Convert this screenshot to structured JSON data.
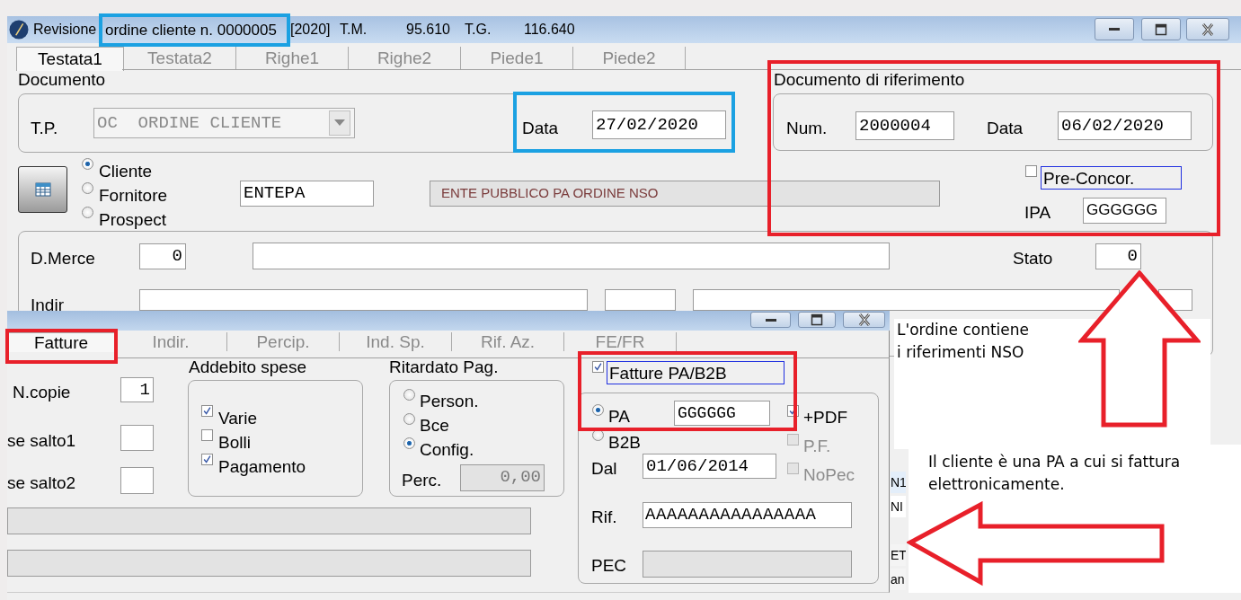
{
  "window": {
    "title": "Revisione",
    "title_highlight": "ordine cliente n. 0000005",
    "title_suffix": "[2020]",
    "totals": [
      {
        "label": "T.M.",
        "value": "95.610"
      },
      {
        "label": "T.G.",
        "value": "116.640"
      }
    ]
  },
  "tabs": [
    {
      "label": "Testata1",
      "selected": true
    },
    {
      "label": "Testata2",
      "selected": false
    },
    {
      "label": "Righe1",
      "selected": false
    },
    {
      "label": "Righe2",
      "selected": false
    },
    {
      "label": "Piede1",
      "selected": false
    },
    {
      "label": "Piede2",
      "selected": false
    }
  ],
  "documento": {
    "heading": "Documento",
    "type_label": "T.P.",
    "type_value": "OC  ORDINE CLIENTE",
    "type_disabled": true,
    "date_label": "Data",
    "date_value": "27/02/2020"
  },
  "party": {
    "options": [
      {
        "label": "Cliente",
        "selected": true
      },
      {
        "label": "Fornitore",
        "selected": false
      },
      {
        "label": "Prospect",
        "selected": false
      }
    ],
    "code": "ENTEPA",
    "description": "ENTE PUBBLICO PA ORDINE NSO"
  },
  "riferimento": {
    "heading": "Documento di riferimento",
    "num_label": "Num.",
    "num_value": "2000004",
    "date_label": "Data",
    "date_value": "06/02/2020",
    "pre_concor": {
      "label": "Pre-Concor.",
      "checked": false
    },
    "ipa_label": "IPA",
    "ipa_value": "GGGGGG"
  },
  "destinazione": {
    "merce_label": "D.Merce",
    "merce_value": "0",
    "stato_label": "Stato",
    "stato_value": "0",
    "indir_label": "Indir"
  },
  "dialog": {
    "tabs": [
      {
        "label": "Fatture",
        "selected": true
      },
      {
        "label": "Indir.",
        "selected": false
      },
      {
        "label": "Percip.",
        "selected": false
      },
      {
        "label": "Ind. Sp.",
        "selected": false
      },
      {
        "label": "Rif. Az.",
        "selected": false
      },
      {
        "label": "FE/FR",
        "selected": false
      }
    ],
    "copies_label": "N.copie",
    "copies_value": "1",
    "skip1_label": "se salto1",
    "skip2_label": "se salto2",
    "addebito": {
      "title": "Addebito spese",
      "items": [
        {
          "label": "Varie",
          "checked": true
        },
        {
          "label": "Bolli",
          "checked": false
        },
        {
          "label": "Pagamento",
          "checked": true
        }
      ]
    },
    "ritardato": {
      "title": "Ritardato Pag.",
      "options": [
        {
          "label": "Person.",
          "selected": false
        },
        {
          "label": "Bce",
          "selected": false
        },
        {
          "label": "Config.",
          "selected": true
        }
      ],
      "perc_label": "Perc.",
      "perc_value": "0,00"
    },
    "einvoice": {
      "label": "Fatture PA/B2B",
      "checked": true,
      "types": [
        {
          "label": "PA",
          "selected": true
        },
        {
          "label": "B2B",
          "selected": false
        }
      ],
      "code": "GGGGGG",
      "flags": [
        {
          "label": "+PDF",
          "checked": true,
          "disabled": false
        },
        {
          "label": "P.F.",
          "checked": false,
          "disabled": true
        },
        {
          "label": "NoPec",
          "checked": false,
          "disabled": true
        }
      ],
      "from_label": "Dal",
      "from_value": "01/06/2014",
      "ref_label": "Rif.",
      "ref_value": "AAAAAAAAAAAAAAAA",
      "pec_label": "PEC"
    }
  },
  "behind_fragments": [
    "N1",
    "NI",
    "ET",
    "an"
  ],
  "notes": [
    {
      "text": "L'ordine contiene\ni riferimenti NSO"
    },
    {
      "text": "Il cliente è una PA a cui si fattura elettronicamente."
    }
  ]
}
